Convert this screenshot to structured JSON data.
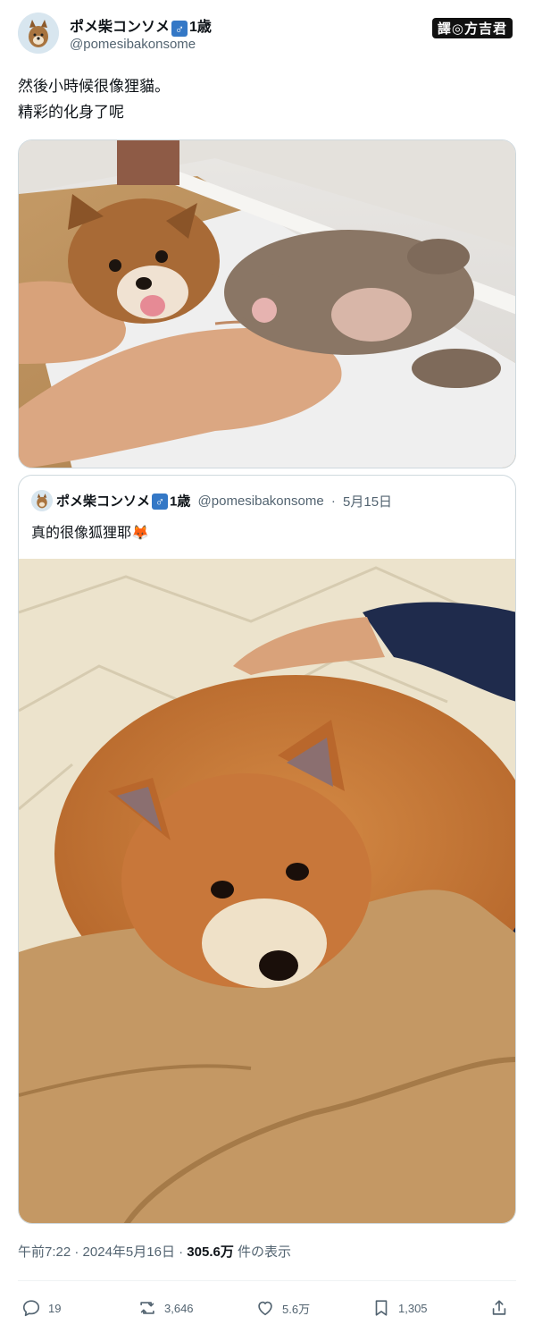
{
  "author": {
    "display_name": "ポメ柴コンソメ",
    "gender_symbol": "♂",
    "age": "1歳",
    "handle": "@pomesibakonsome"
  },
  "translator_badge": "譯◎方吉君",
  "tweet": {
    "line1": "然後小時候很像狸貓。",
    "line2": "精彩的化身了呢"
  },
  "quoted": {
    "display_name": "ポメ柴コンソメ",
    "gender_symbol": "♂",
    "age": "1歳",
    "handle": "@pomesibakonsome",
    "separator": "·",
    "date": "5月15日",
    "text": "真的很像狐狸耶🦊"
  },
  "timestamp": {
    "time": "午前7:22",
    "sep1": "·",
    "date": "2024年5月16日",
    "sep2": "·",
    "views": "305.6万",
    "views_label": "件の表示"
  },
  "actions": {
    "replies": "19",
    "reposts": "3,646",
    "likes": "5.6万",
    "bookmarks": "1,305"
  },
  "colors": {
    "accent": "#1d9bf0",
    "text_secondary": "#536471",
    "border": "#cfd9de"
  }
}
